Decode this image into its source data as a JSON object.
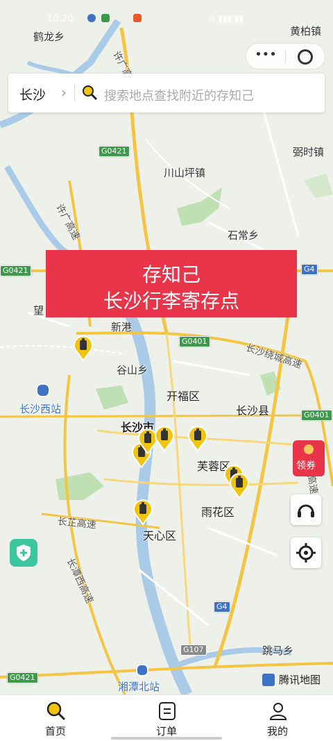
{
  "status_bar": {
    "time": "10:20"
  },
  "search": {
    "city": "长沙",
    "placeholder": "搜索地点查找附近的存知己"
  },
  "banner": {
    "line1": "存知己",
    "line2": "长沙行李寄存点"
  },
  "map_labels": [
    {
      "id": "helongxiang",
      "text": "鹤龙乡"
    },
    {
      "id": "huangboz",
      "text": "黄柏镇"
    },
    {
      "id": "chuanshanping",
      "text": "川山坪镇"
    },
    {
      "id": "zhangshizhen",
      "text": "弼时镇"
    },
    {
      "id": "shichangxiang",
      "text": "石常乡"
    },
    {
      "id": "wang",
      "text": "望"
    },
    {
      "id": "xingang",
      "text": "新港"
    },
    {
      "id": "gushanxiang",
      "text": "谷山乡"
    },
    {
      "id": "kaifuqu",
      "text": "开福区"
    },
    {
      "id": "changshaxian",
      "text": "长沙县"
    },
    {
      "id": "changshaxizhan",
      "text": "长沙西站"
    },
    {
      "id": "changshashi",
      "text": "长沙市"
    },
    {
      "id": "furongqu",
      "text": "芙蓉区"
    },
    {
      "id": "yuhuaqu",
      "text": "雨花区"
    },
    {
      "id": "tianxinqu",
      "text": "天心区"
    },
    {
      "id": "tiaomaxiang",
      "text": "跳马乡"
    },
    {
      "id": "xiangtanbeizhan",
      "text": "湘潭北站"
    },
    {
      "id": "xuguang_top",
      "text": "许广高速"
    },
    {
      "id": "xuguang_left",
      "text": "许广高速"
    },
    {
      "id": "raocheng",
      "text": "长沙绕城高速"
    },
    {
      "id": "raocheng_right",
      "text": "城高速"
    },
    {
      "id": "changzhi",
      "text": "长芷高速"
    },
    {
      "id": "changtanxi",
      "text": "长潭西高速"
    }
  ],
  "road_shields": [
    {
      "id": "g0421a",
      "text": "G0421"
    },
    {
      "id": "g0421b",
      "text": "G0421"
    },
    {
      "id": "g0421c",
      "text": "G0421"
    },
    {
      "id": "g4a",
      "text": "G4"
    },
    {
      "id": "g0401a",
      "text": "G0401"
    },
    {
      "id": "g0401b",
      "text": "G0401"
    },
    {
      "id": "g4b",
      "text": "G4"
    },
    {
      "id": "g107",
      "text": "G107"
    }
  ],
  "coupon": {
    "label": "领券"
  },
  "map_brand": "腾讯地图",
  "tabs": [
    {
      "label": "首页",
      "icon": "search-icon",
      "active": true
    },
    {
      "label": "订单",
      "icon": "order-icon",
      "active": false
    },
    {
      "label": "我的",
      "icon": "user-icon",
      "active": false
    }
  ],
  "colors": {
    "brand_red": "#e8354a",
    "marker_yellow": "#f1c40f",
    "highway_yellow": "#f4c542",
    "water": "#a9cbe8",
    "green": "#bfe0b3"
  }
}
